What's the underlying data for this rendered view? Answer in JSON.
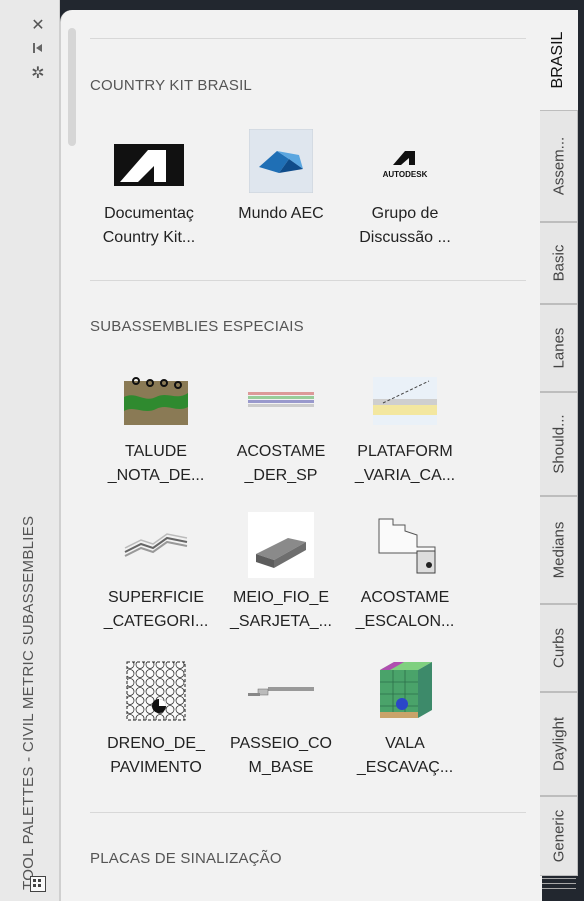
{
  "window": {
    "title": "TOOL PALETTES - CIVIL METRIC SUBASSEMBLIES",
    "close_icon": "close-icon",
    "autohide_icon": "autohide-icon",
    "properties_icon": "gear-icon"
  },
  "sections": [
    {
      "title": "COUNTRY KIT BRASIL",
      "tools": [
        {
          "line1": "Documentaç",
          "line2": "Country Kit..."
        },
        {
          "line1": "Mundo AEC",
          "line2": ""
        },
        {
          "line1": "Grupo de",
          "line2": "Discussão ..."
        }
      ]
    },
    {
      "title": "SUBASSEMBLIES ESPECIAIS",
      "tools": [
        {
          "line1": "TALUDE",
          "line2": "_NOTA_DE..."
        },
        {
          "line1": "ACOSTAME",
          "line2": "_DER_SP"
        },
        {
          "line1": "PLATAFORM",
          "line2": "_VARIA_CA..."
        },
        {
          "line1": "SUPERFICIE",
          "line2": "_CATEGORI..."
        },
        {
          "line1": "MEIO_FIO_E",
          "line2": "_SARJETA_..."
        },
        {
          "line1": "ACOSTAME",
          "line2": "_ESCALON..."
        },
        {
          "line1": "DRENO_DE_",
          "line2": "PAVIMENTO"
        },
        {
          "line1": "PASSEIO_CO",
          "line2": "M_BASE"
        },
        {
          "line1": "VALA",
          "line2": "_ESCAVAÇ..."
        }
      ]
    },
    {
      "title": "PLACAS DE SINALIZAÇÃO",
      "tools": []
    }
  ],
  "tabs": [
    {
      "label": "BRASIL",
      "active": true
    },
    {
      "label": "Assem...",
      "active": false
    },
    {
      "label": "Basic",
      "active": false
    },
    {
      "label": "Lanes",
      "active": false
    },
    {
      "label": "Should...",
      "active": false
    },
    {
      "label": "Medians",
      "active": false
    },
    {
      "label": "Curbs",
      "active": false
    },
    {
      "label": "Daylight",
      "active": false
    },
    {
      "label": "Generic",
      "active": false
    }
  ],
  "logo_text": "AUTODESK"
}
